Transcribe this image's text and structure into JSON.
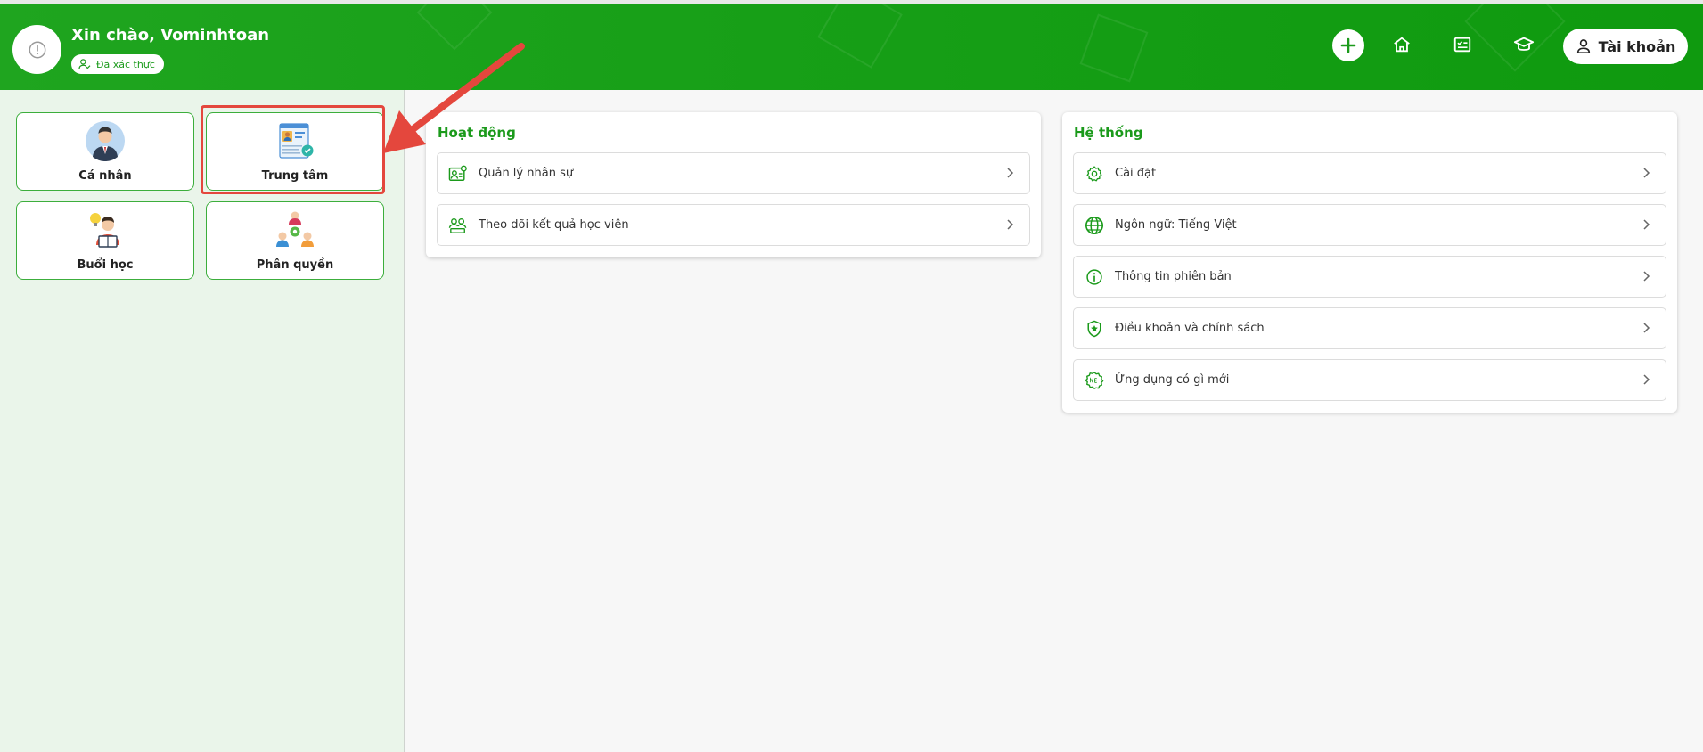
{
  "header": {
    "greeting": "Xin chào, Vominhtoan",
    "verified_label": "Đã xác thực",
    "account_label": "Tài khoản"
  },
  "sidebar": {
    "tiles": [
      {
        "label": "Cá nhân"
      },
      {
        "label": "Trung tâm"
      },
      {
        "label": "Buổi học"
      },
      {
        "label": "Phân quyền"
      }
    ]
  },
  "activity": {
    "title": "Hoạt động",
    "items": [
      {
        "label": "Quản lý nhân sự",
        "icon": "staff-icon"
      },
      {
        "label": "Theo dõi kết quả học viên",
        "icon": "students-icon"
      }
    ]
  },
  "system": {
    "title": "Hệ thống",
    "items": [
      {
        "label": "Cài đặt",
        "icon": "gear-icon"
      },
      {
        "label": "Ngôn ngữ: Tiếng Việt",
        "icon": "globe-icon"
      },
      {
        "label": "Thông tin phiên bản",
        "icon": "info-icon"
      },
      {
        "label": "Điều khoản và chính sách",
        "icon": "shield-icon"
      },
      {
        "label": "Ứng dụng có gì mới",
        "icon": "new-badge-icon"
      }
    ]
  },
  "colors": {
    "brand_green": "#1b9a1b",
    "annotation_red": "#e4473d"
  }
}
